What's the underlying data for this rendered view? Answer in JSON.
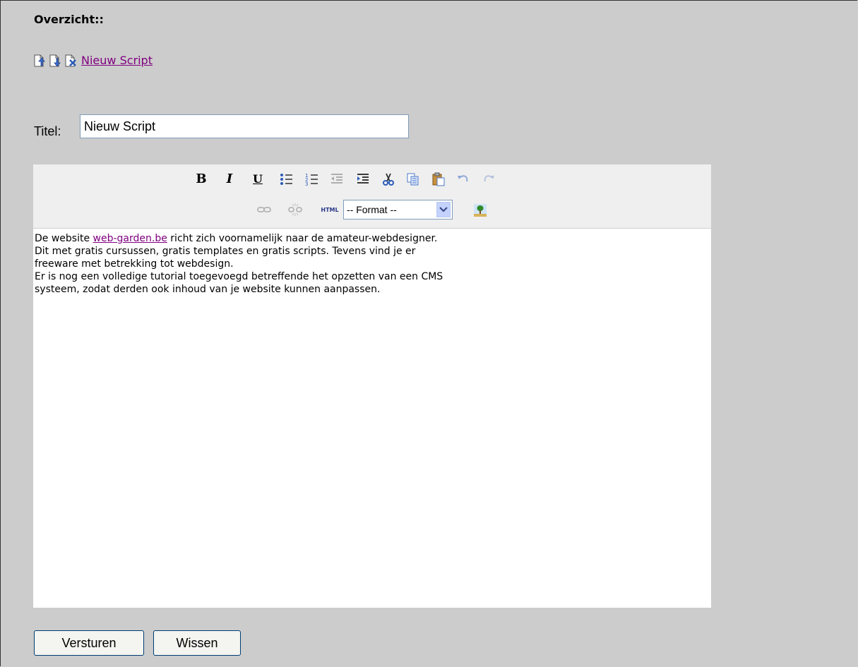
{
  "header": {
    "title": "Overzicht::"
  },
  "actions": {
    "icons": [
      "page-up-icon",
      "page-down-icon",
      "page-delete-icon"
    ],
    "new_script_link": "Nieuw Script"
  },
  "form": {
    "title_label": "Titel:",
    "title_value": "Nieuw Script"
  },
  "toolbar": {
    "bold": "B",
    "italic": "I",
    "underline": "U",
    "html_label": "HTML",
    "format_selected": "-- Format --"
  },
  "editor": {
    "line1_before": "De website ",
    "link_text": "web-garden.be",
    "line1_after": " richt zich voornamelijk naar de amateur-webdesigner.",
    "line2": "Dit met gratis cursussen, gratis templates en gratis scripts. Tevens vind je er",
    "line3": "freeware met betrekking tot webdesign.",
    "line4": "Er is nog een volledige tutorial toegevoegd betreffende het opzetten van een CMS",
    "line5": "systeem, zodat derden ook inhoud van je website kunnen aanpassen."
  },
  "buttons": {
    "submit": "Versturen",
    "clear": "Wissen"
  }
}
